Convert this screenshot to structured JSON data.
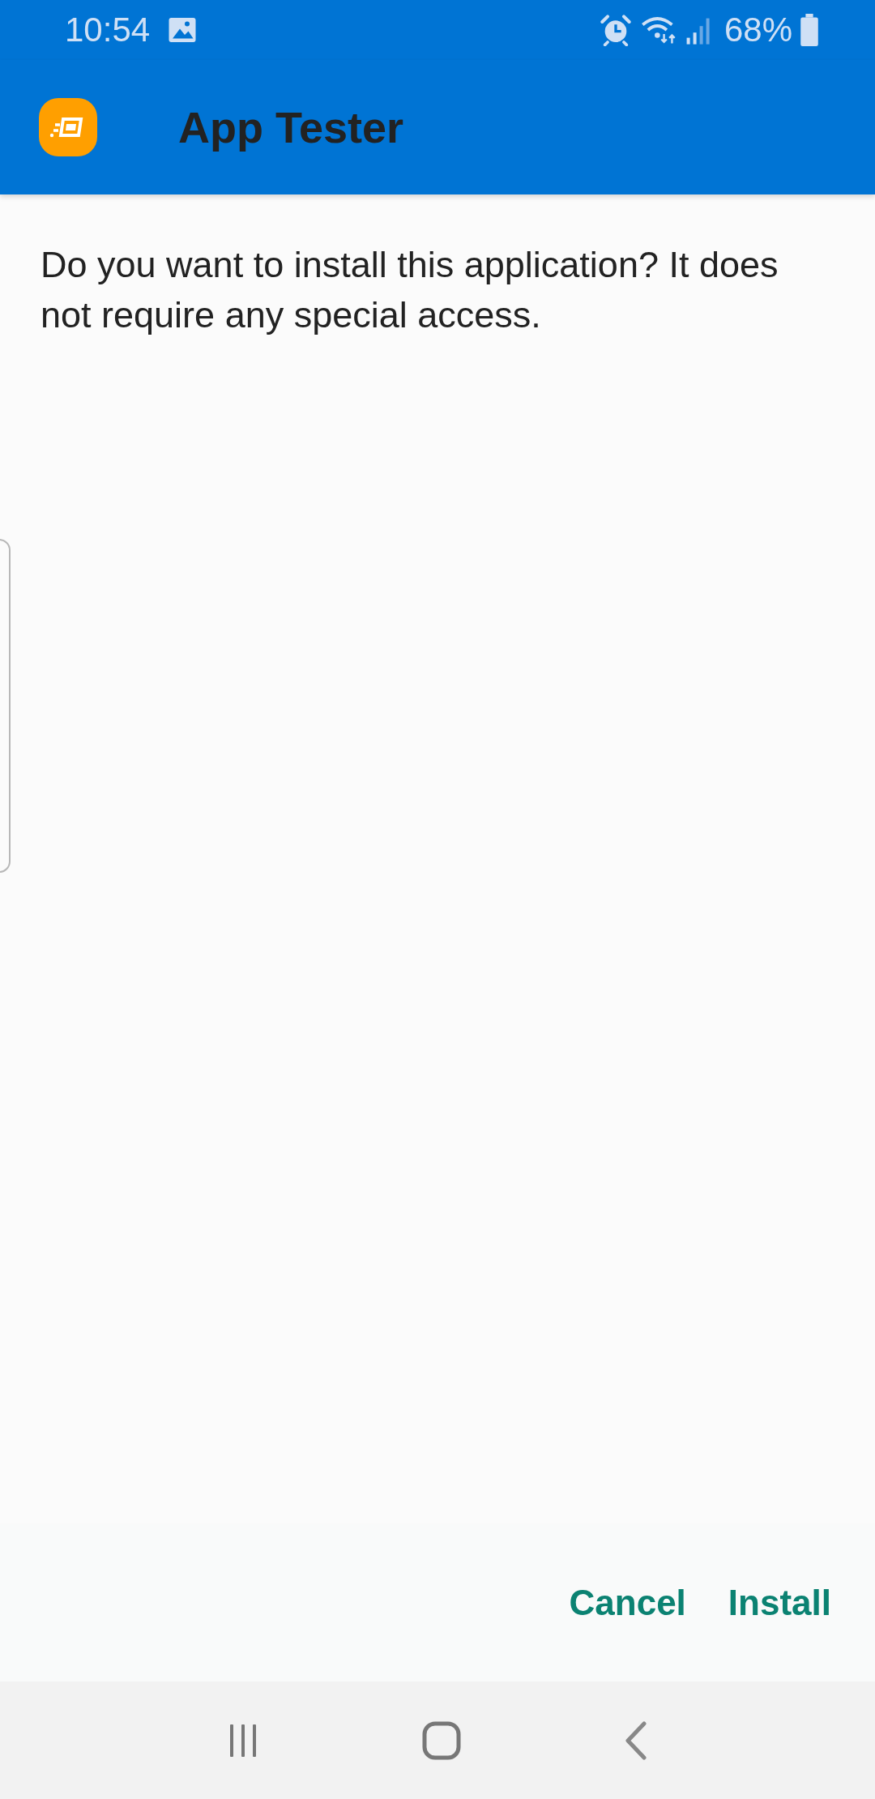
{
  "status_bar": {
    "time": "10:54",
    "battery": "68%"
  },
  "app_bar": {
    "title": "App Tester"
  },
  "message": "Do you want to install this application? It does not require any special access.",
  "buttons": [
    {
      "label": "Cancel"
    },
    {
      "label": "Install"
    }
  ]
}
